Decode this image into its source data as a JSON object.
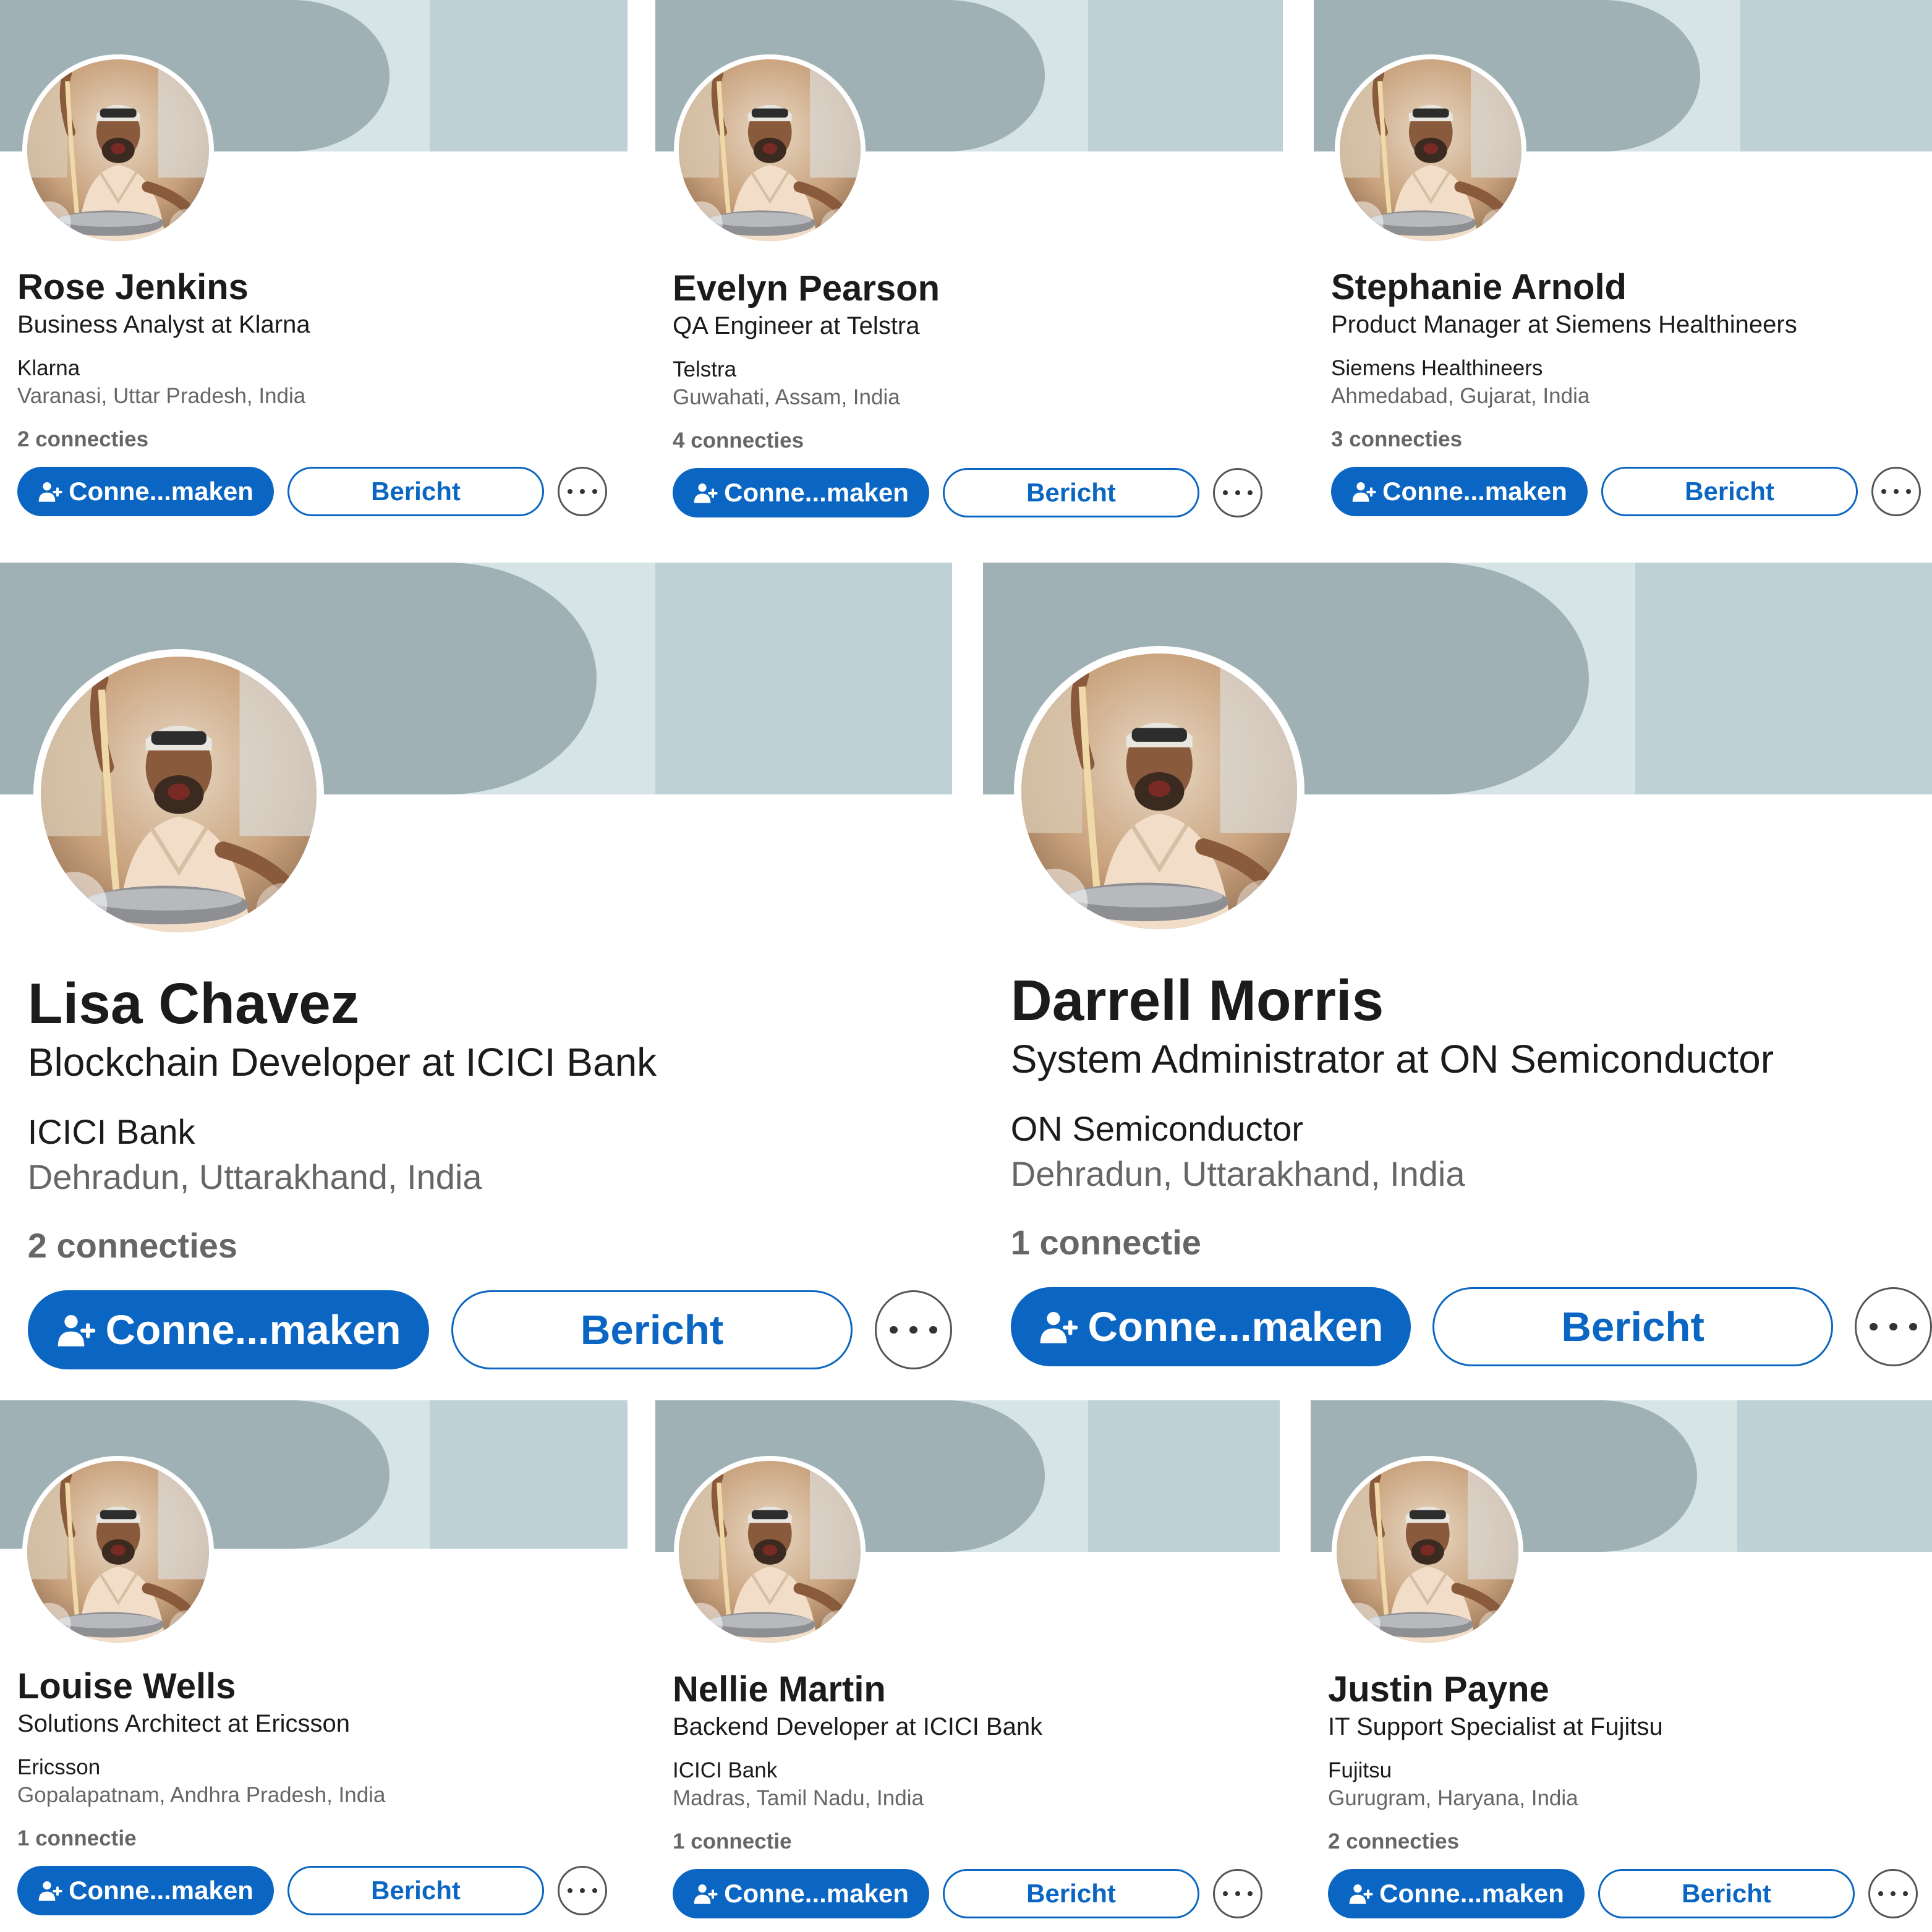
{
  "ui": {
    "connect_label": "Conne...maken",
    "message_label": "Bericht"
  },
  "profiles": [
    {
      "name": "Rose Jenkins",
      "headline": "Business Analyst at Klarna",
      "company": "Klarna",
      "location": "Varanasi, Uttar Pradesh, India",
      "connections": "2 connecties"
    },
    {
      "name": "Evelyn Pearson",
      "headline": "QA Engineer at Telstra",
      "company": "Telstra",
      "location": "Guwahati, Assam, India",
      "connections": "4 connecties"
    },
    {
      "name": "Stephanie Arnold",
      "headline": "Product Manager at Siemens Healthineers",
      "company": "Siemens Healthineers",
      "location": "Ahmedabad, Gujarat, India",
      "connections": "3 connecties"
    },
    {
      "name": "Lisa Chavez",
      "headline": "Blockchain Developer at ICICI Bank",
      "company": "ICICI Bank",
      "location": "Dehradun, Uttarakhand, India",
      "connections": "2 connecties"
    },
    {
      "name": "Darrell Morris",
      "headline": "System Administrator at ON Semiconductor",
      "company": "ON Semiconductor",
      "location": "Dehradun, Uttarakhand, India",
      "connections": "1 connectie"
    },
    {
      "name": "Louise Wells",
      "headline": "Solutions Architect at Ericsson",
      "company": "Ericsson",
      "location": "Gopalapatnam, Andhra Pradesh, India",
      "connections": "1 connectie"
    },
    {
      "name": "Nellie Martin",
      "headline": "Backend Developer at ICICI Bank",
      "company": "ICICI Bank",
      "location": "Madras, Tamil Nadu, India",
      "connections": "1 connectie"
    },
    {
      "name": "Justin Payne",
      "headline": "IT Support Specialist at Fujitsu",
      "company": "Fujitsu",
      "location": "Gurugram, Haryana, India",
      "connections": "2 connecties"
    }
  ],
  "colors": {
    "primary": "#0a66c2",
    "banner_dark": "#9fb1b5",
    "banner_light": "#d7e4e6",
    "banner_mid": "#bed1d6"
  },
  "icons": {
    "connect": "person-add-icon",
    "more": "ellipsis-icon",
    "avatar": "profile-photo"
  }
}
